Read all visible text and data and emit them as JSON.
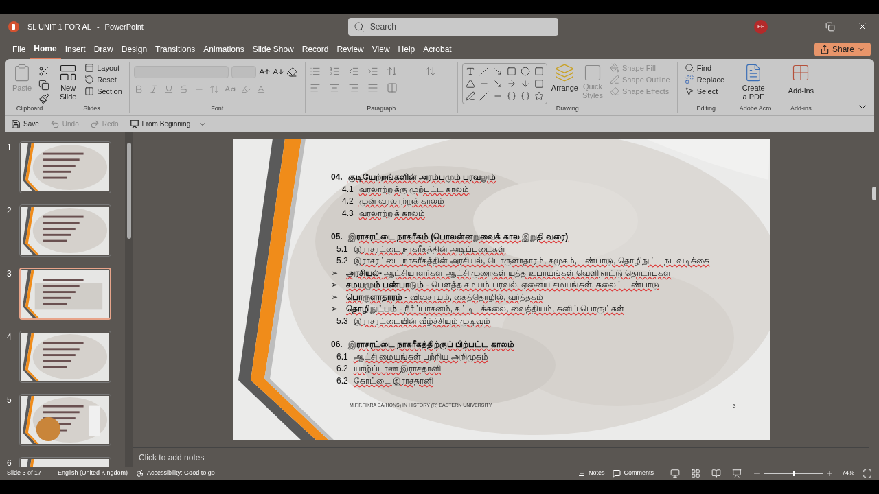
{
  "title_bar": {
    "file_name": "SL UNIT 1 FOR AL",
    "separator": "-",
    "app_name": "PowerPoint",
    "search_placeholder": "Search",
    "avatar": "FF"
  },
  "menu_tabs": [
    {
      "label": "File",
      "selected": false
    },
    {
      "label": "Home",
      "selected": true
    },
    {
      "label": "Insert",
      "selected": false
    },
    {
      "label": "Draw",
      "selected": false
    },
    {
      "label": "Design",
      "selected": false
    },
    {
      "label": "Transitions",
      "selected": false
    },
    {
      "label": "Animations",
      "selected": false
    },
    {
      "label": "Slide Show",
      "selected": false
    },
    {
      "label": "Record",
      "selected": false
    },
    {
      "label": "Review",
      "selected": false
    },
    {
      "label": "View",
      "selected": false
    },
    {
      "label": "Help",
      "selected": false
    },
    {
      "label": "Acrobat",
      "selected": false
    }
  ],
  "share_button": "Share",
  "ribbon": {
    "clipboard": {
      "label": "Clipboard",
      "paste": {
        "label": "Paste",
        "disabled": true
      }
    },
    "slides": {
      "label": "Slides",
      "new_slide": [
        "New",
        "Slide"
      ],
      "layout": "Layout",
      "reset": "Reset",
      "section": "Section"
    },
    "font": {
      "label": "Font"
    },
    "paragraph": {
      "label": "Paragraph"
    },
    "drawing": {
      "label": "Drawing",
      "arrange": "Arrange",
      "quick_styles": {
        "label": [
          "Quick",
          "Styles"
        ],
        "disabled": true
      },
      "shape_fill": {
        "label": "Shape Fill",
        "disabled": true
      },
      "shape_outline": {
        "label": "Shape Outline",
        "disabled": true
      },
      "shape_effects": {
        "label": "Shape Effects",
        "disabled": true
      }
    },
    "editing": {
      "label": "Editing",
      "find": "Find",
      "replace": "Replace",
      "select": "Select"
    },
    "adobe": {
      "label": "Adobe Acro...",
      "create_pdf": [
        "Create",
        "a PDF"
      ]
    },
    "addins": {
      "label": "Add-ins",
      "button": "Add-ins"
    }
  },
  "quick_access": [
    {
      "label": "Save",
      "disabled": false
    },
    {
      "label": "Undo",
      "disabled": true
    },
    {
      "label": "Redo",
      "disabled": true
    },
    {
      "label": "From Beginning",
      "disabled": false
    }
  ],
  "thumbnails": [
    {
      "number": "1",
      "selected": false
    },
    {
      "number": "2",
      "selected": false
    },
    {
      "number": "3",
      "selected": true
    },
    {
      "number": "4",
      "selected": false
    },
    {
      "number": "5",
      "selected": false
    },
    {
      "number": "6",
      "selected": false
    }
  ],
  "slide": {
    "sections": [
      {
        "number": "04.",
        "title": "குடியேற்றங்களின் அரம்பமும் பரவலும்",
        "items": [
          {
            "kind": "sub",
            "number": "4.1",
            "text": "வரலாற்றுக்கு முற்பட்ட காலம்"
          },
          {
            "kind": "sub",
            "number": "4.2",
            "text": "முன் வரலாற்றுக் காலம்"
          },
          {
            "kind": "sub",
            "number": "4.3",
            "text": "வரலாற்றுக் காலம்"
          }
        ]
      },
      {
        "number": "05.",
        "title": "இராசரட்டை நாகரீகம் (பொலன்னறுவைக் கால இறுதி வரை)",
        "items": [
          {
            "kind": "sub",
            "number": "5.1",
            "text": "இராசரட்டை நாகரீகத்தின் அடிப்படைகள்"
          },
          {
            "kind": "sub",
            "number": "5.2",
            "text": "இராசரட்டை நாகரீகத்தின் அரசியல், பொருளாதாரம், சமூகம், பண்பாடு, தொழிநுட்ப நடவடிக்கை"
          },
          {
            "kind": "bullet",
            "number": "➢",
            "text": "**அரசியல்-** ஆட்சியாளர்கள் ஆட்சி முறைகள் யுத்த உபாயங்கள் வெளிநாட்டு தொடர்புகள்"
          },
          {
            "kind": "bullet",
            "number": "➢",
            "text": "**சமயமும் பண்பாடும்** - பௌத்த சமயம் பரவல், ஏனைய சமயங்கள், கலைப் பண்பாடு"
          },
          {
            "kind": "bullet",
            "number": "➢",
            "text": "**பொருளாதாரம்** - விவசாயம், கைத்தொழில், வர்த்தகம்"
          },
          {
            "kind": "bullet",
            "number": "➢",
            "text": "**தொழிநுட்பம்** - நீர்ப்பாசனம், கட்டிடக்கலை, வைத்தியம், கனிப் பொருட்கள்"
          },
          {
            "kind": "sub",
            "number": "5.3",
            "text": "இராசரட்டையின் வீழ்ச்சியும் முடிவும்"
          }
        ]
      },
      {
        "number": "06.",
        "title": "இராசரட்டை நாகரீகத்திற்குப் பிற்பட்ட காலம்",
        "items": [
          {
            "kind": "sub",
            "number": "6.1",
            "text": "ஆட்சி மையங்கள் பற்றிய அறிமுகம்"
          },
          {
            "kind": "sub",
            "number": "6.2",
            "text": "யாழ்ப்பாண இராசதானி"
          },
          {
            "kind": "sub",
            "number": "6.2",
            "text": "கோட்டை இராசதானி"
          }
        ]
      }
    ],
    "footer": "M.F.F.FIKRA BA(HONS) IN HISTORY (R) EASTERN UNIVERSITY",
    "page_number": "3"
  },
  "notes_placeholder": "Click to add notes",
  "status_bar": {
    "slide_info": "Slide 3 of 17",
    "language": "English (United Kingdom)",
    "accessibility": "Accessibility: Good to go",
    "notes": "Notes",
    "comments": "Comments",
    "zoom": "74%",
    "zoom_level": {
      "level": 0.5
    }
  }
}
